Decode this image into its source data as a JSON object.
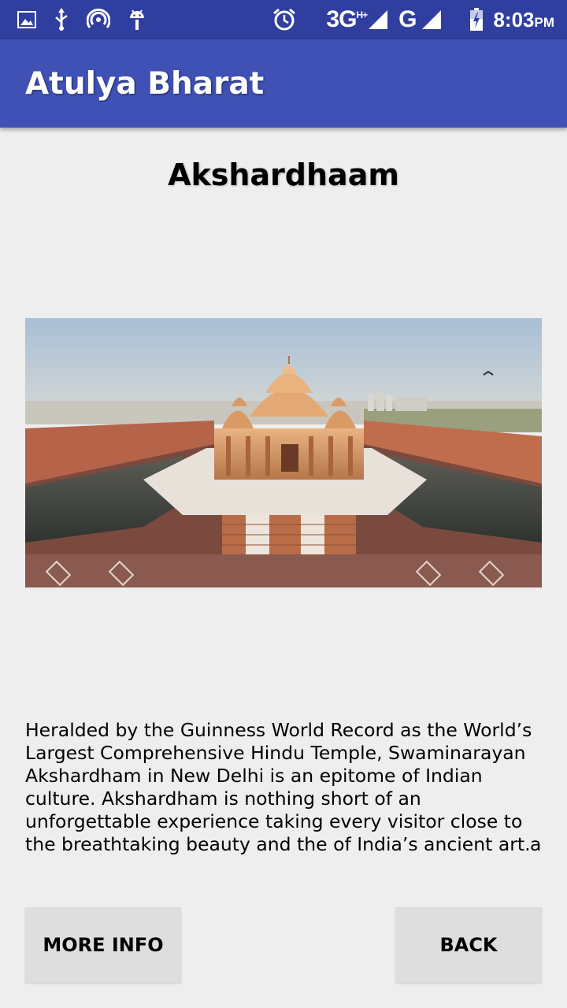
{
  "status_bar": {
    "icons_left": [
      "image-icon",
      "usb-icon",
      "hotspot-icon",
      "android-icon"
    ],
    "icons_right": [
      "alarm-icon",
      "signal-icon",
      "battery-icon"
    ],
    "network_primary": "3G",
    "network_primary_sup": "H+",
    "network_secondary": "G",
    "time": "8:03",
    "time_suffix": "PM"
  },
  "app_bar": {
    "title": "Atulya Bharat",
    "color": "#3f51b5",
    "status_color": "#303f9f"
  },
  "content": {
    "title": "Akshardhaam",
    "image_subject": "akshardham-temple-photo",
    "description": "Heralded by the Guinness World Record as the World’s Largest Comprehensive Hindu Temple, Swaminarayan Akshardham in New Delhi is an epitome of Indian culture. Akshardham is nothing short of an unforgettable experience taking every visitor close to the breathtaking beauty and the of India’s ancient art.",
    "trailing_char": "a"
  },
  "buttons": {
    "more_info": "MORE INFO",
    "back": "BACK"
  }
}
